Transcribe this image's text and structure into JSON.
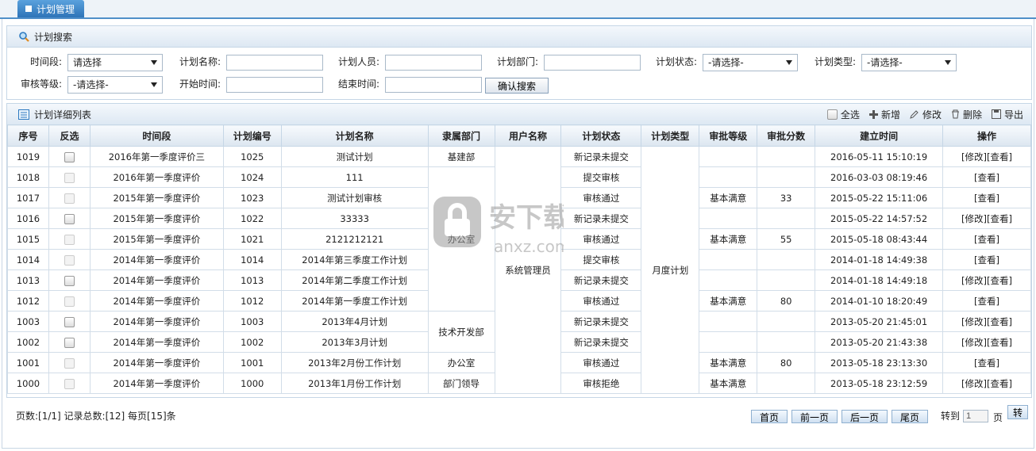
{
  "tab": {
    "label": "计划管理"
  },
  "search": {
    "title": "计划搜索",
    "fields": {
      "time_period": {
        "label": "时间段:",
        "value": "请选择"
      },
      "plan_name": {
        "label": "计划名称:",
        "value": ""
      },
      "plan_person": {
        "label": "计划人员:",
        "value": ""
      },
      "plan_dept": {
        "label": "计划部门:",
        "value": ""
      },
      "plan_status": {
        "label": "计划状态:",
        "value": "-请选择-"
      },
      "plan_type": {
        "label": "计划类型:",
        "value": "-请选择-"
      },
      "review_level": {
        "label": "审核等级:",
        "value": "-请选择-"
      },
      "start_time": {
        "label": "开始时间:",
        "value": ""
      },
      "end_time": {
        "label": "结束时间:",
        "value": ""
      }
    },
    "confirm_label": "确认搜索"
  },
  "list": {
    "title": "计划详细列表",
    "toolbar": {
      "select_all": "全选",
      "add": "新增",
      "edit": "修改",
      "delete": "删除",
      "export": "导出"
    },
    "columns": [
      "序号",
      "反选",
      "时间段",
      "计划编号",
      "计划名称",
      "隶属部门",
      "用户名称",
      "计划状态",
      "计划类型",
      "审批等级",
      "审批分数",
      "建立时间",
      "操作"
    ],
    "rows": [
      {
        "seq": "1019",
        "cb_enabled": true,
        "period": "2016年第一季度评价三",
        "code": "1025",
        "name": "测试计划",
        "status": "新记录未提交",
        "level": "",
        "score": "",
        "created": "2016-05-11 15:10:19",
        "ops": "[修改][查看]"
      },
      {
        "seq": "1018",
        "cb_enabled": false,
        "period": "2016年第一季度评价",
        "code": "1024",
        "name": "111",
        "status": "提交审核",
        "level": "",
        "score": "",
        "created": "2016-03-03 08:19:46",
        "ops": "[查看]"
      },
      {
        "seq": "1017",
        "cb_enabled": false,
        "period": "2015年第一季度评价",
        "code": "1023",
        "name": "测试计划审核",
        "status": "审核通过",
        "level": "基本满意",
        "score": "33",
        "created": "2015-05-22 15:11:06",
        "ops": "[查看]"
      },
      {
        "seq": "1016",
        "cb_enabled": true,
        "period": "2015年第一季度评价",
        "code": "1022",
        "name": "33333",
        "status": "新记录未提交",
        "level": "",
        "score": "",
        "created": "2015-05-22 14:57:52",
        "ops": "[修改][查看]"
      },
      {
        "seq": "1015",
        "cb_enabled": false,
        "period": "2015年第一季度评价",
        "code": "1021",
        "name": "2121212121",
        "status": "审核通过",
        "level": "基本满意",
        "score": "55",
        "created": "2015-05-18 08:43:44",
        "ops": "[查看]"
      },
      {
        "seq": "1014",
        "cb_enabled": false,
        "period": "2014年第一季度评价",
        "code": "1014",
        "name": "2014年第三季度工作计划",
        "status": "提交审核",
        "level": "",
        "score": "",
        "created": "2014-01-18 14:49:38",
        "ops": "[查看]"
      },
      {
        "seq": "1013",
        "cb_enabled": true,
        "period": "2014年第一季度评价",
        "code": "1013",
        "name": "2014年第二季度工作计划",
        "status": "新记录未提交",
        "level": "",
        "score": "",
        "created": "2014-01-18 14:49:18",
        "ops": "[修改][查看]"
      },
      {
        "seq": "1012",
        "cb_enabled": false,
        "period": "2014年第一季度评价",
        "code": "1012",
        "name": "2014年第一季度工作计划",
        "status": "审核通过",
        "level": "基本满意",
        "score": "80",
        "created": "2014-01-10 18:20:49",
        "ops": "[查看]"
      },
      {
        "seq": "1003",
        "cb_enabled": true,
        "period": "2014年第一季度评价",
        "code": "1003",
        "name": "2013年4月计划",
        "status": "新记录未提交",
        "level": "",
        "score": "",
        "created": "2013-05-20 21:45:01",
        "ops": "[修改][查看]"
      },
      {
        "seq": "1002",
        "cb_enabled": true,
        "period": "2014年第一季度评价",
        "code": "1002",
        "name": "2013年3月计划",
        "status": "新记录未提交",
        "level": "",
        "score": "",
        "created": "2013-05-20 21:43:38",
        "ops": "[修改][查看]"
      },
      {
        "seq": "1001",
        "cb_enabled": false,
        "period": "2014年第一季度评价",
        "code": "1001",
        "name": "2013年2月份工作计划",
        "status": "审核通过",
        "level": "基本满意",
        "score": "80",
        "created": "2013-05-18 23:13:30",
        "ops": "[查看]"
      },
      {
        "seq": "1000",
        "cb_enabled": false,
        "period": "2014年第一季度评价",
        "code": "1000",
        "name": "2013年1月份工作计划",
        "status": "审核拒绝",
        "level": "基本满意",
        "score": "",
        "created": "2013-05-18 23:12:59",
        "ops": "[修改][查看]"
      }
    ],
    "dept_groups": [
      {
        "label": "基建部",
        "rows": 1
      },
      {
        "label": "办公室",
        "rows": 7
      },
      {
        "label": "技术开发部",
        "rows": 2
      },
      {
        "label": "办公室",
        "rows": 1
      },
      {
        "label": "部门领导",
        "rows": 1
      }
    ],
    "user_group": {
      "label": "系统管理员"
    },
    "type_group": {
      "label": "月度计划"
    }
  },
  "pager": {
    "info": "页数:[1/1] 记录总数:[12] 每页[15]条",
    "first": "首页",
    "prev": "前一页",
    "next": "后一页",
    "last": "尾页",
    "goto_label": "转到",
    "page_value": "1",
    "page_unit": "页",
    "go": "转"
  },
  "watermark": {
    "text": "安下载",
    "sub": "anxz.com"
  }
}
